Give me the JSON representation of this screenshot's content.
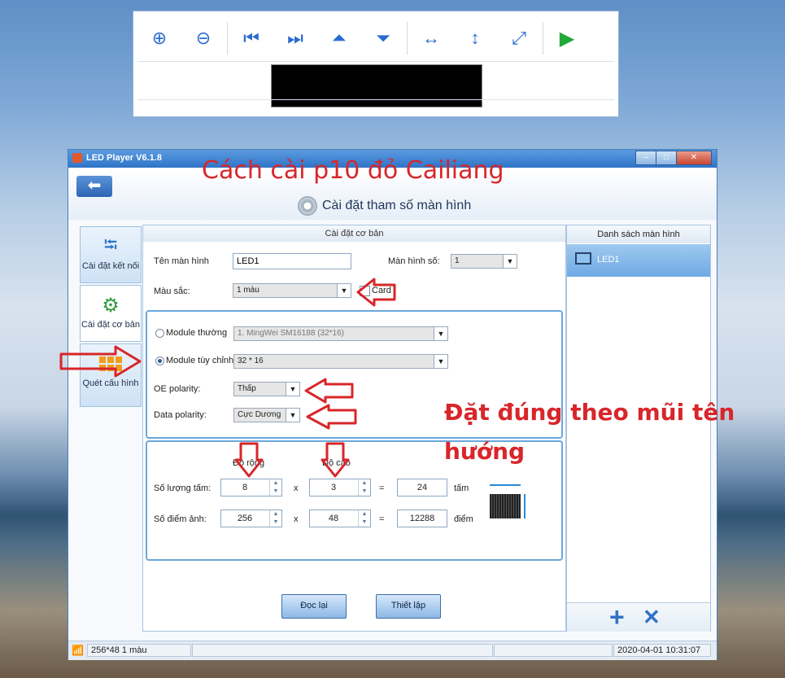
{
  "preview": {
    "toolbar": [
      "zoom-in-icon",
      "zoom-out-icon",
      "skip-start-icon",
      "skip-end-icon",
      "align-top-icon",
      "align-bottom-icon",
      "stretch-horizontal-icon",
      "stretch-vertical-icon",
      "fullscreen-icon",
      "play-icon"
    ]
  },
  "window": {
    "title": "LED Player V6.1.8",
    "annotation_title": "Cách cài p10 đỏ Cailiang",
    "settings_title": "Cài đặt tham số màn hình",
    "minimize": "–",
    "maximize": "□",
    "close": "✕"
  },
  "sidebar": {
    "items": [
      {
        "label": "Cài đặt kết nối",
        "icon": "usb-icon"
      },
      {
        "label": "Cài đặt cơ bản",
        "icon": "gears-icon"
      },
      {
        "label": "Quét cấu hình",
        "icon": "grid-icon"
      }
    ]
  },
  "basic": {
    "header": "Cài đặt cơ bản",
    "screen_name_label": "Tên màn hình",
    "screen_name_value": "LED1",
    "screen_no_label": "Màn hình số:",
    "screen_no_value": "1",
    "color_label": "Màu sắc:",
    "color_value": "1 màu",
    "card_label": "Card"
  },
  "module": {
    "normal_label": "Module thường",
    "normal_value": "1. MingWei SM16188 (32*16)",
    "custom_label": "Module tùy chỉnh",
    "custom_value": "32 * 16",
    "oe_label": "OE polarity:",
    "oe_value": "Thấp",
    "data_label": "Data polarity:",
    "data_value": "Cực Dương"
  },
  "size": {
    "width_header": "Độ rộng",
    "height_header": "Độ cao",
    "panels_label": "Số lượng tấm:",
    "panels_w": "8",
    "panels_h": "3",
    "panels_total": "24",
    "panels_unit": "tấm",
    "pixels_label": "Số điểm ảnh:",
    "pixels_w": "256",
    "pixels_h": "48",
    "pixels_total": "12288",
    "pixels_unit": "điểm",
    "times": "x",
    "equals": "="
  },
  "buttons": {
    "reload": "Đọc lại",
    "setup": "Thiết lập"
  },
  "screen_list": {
    "header": "Danh sách màn hình",
    "items": [
      "LED1"
    ],
    "add": "+",
    "remove": "✕"
  },
  "status": {
    "resolution": "256*48 1 màu",
    "datetime": "2020-04-01 10:31:07"
  },
  "annotations": {
    "note_line1": "Đặt đúng theo mũi tên",
    "note_line2": "hướng"
  }
}
